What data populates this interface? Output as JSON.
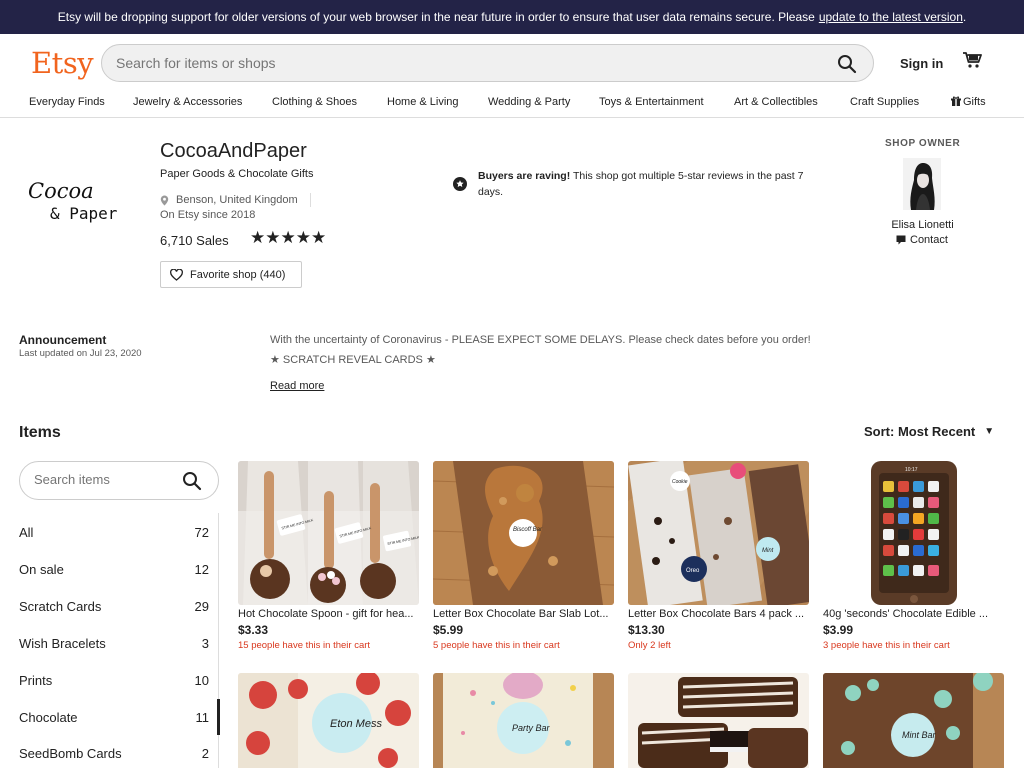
{
  "banner": {
    "text": "Etsy will be dropping support for older versions of your web browser in the near future in order to ensure that user data remains secure. Please",
    "link": "update to the latest version",
    "end": "."
  },
  "header": {
    "logo": "Etsy",
    "search_placeholder": "Search for items or shops",
    "signin": "Sign in"
  },
  "nav": [
    "Everyday Finds",
    "Jewelry & Accessories",
    "Clothing & Shoes",
    "Home & Living",
    "Wedding & Party",
    "Toys & Entertainment",
    "Art & Collectibles",
    "Craft Supplies",
    "Gifts"
  ],
  "shop": {
    "logo_line1": "Cocoa",
    "logo_line2": "& Paper",
    "name": "CocoaAndPaper",
    "tagline": "Paper Goods & Chocolate Gifts",
    "location": "Benson, United Kingdom",
    "since": "On Etsy since 2018",
    "sales": "6,710 Sales",
    "rating_stars": 5,
    "stars": "★★★★★",
    "favorite": "Favorite shop (440)"
  },
  "raving": {
    "bold": "Buyers are raving!",
    "text": " This shop got multiple 5-star reviews in the past 7 days."
  },
  "owner": {
    "heading": "SHOP OWNER",
    "name": "Elisa Lionetti",
    "contact": "Contact"
  },
  "announcement": {
    "title": "Announcement",
    "updated": "Last updated on Jul 23, 2020",
    "line1": "With the uncertainty of Coronavirus - PLEASE EXPECT SOME DELAYS. Please check dates before you order!",
    "line2": "★ SCRATCH REVEAL CARDS ★",
    "read_more": "Read more"
  },
  "items": {
    "heading": "Items",
    "sort": "Sort: Most Recent",
    "search_placeholder": "Search items",
    "sections": [
      {
        "name": "All",
        "count": "72"
      },
      {
        "name": "On sale",
        "count": "12"
      },
      {
        "name": "Scratch Cards",
        "count": "29"
      },
      {
        "name": "Wish Bracelets",
        "count": "3"
      },
      {
        "name": "Prints",
        "count": "10"
      },
      {
        "name": "Chocolate",
        "count": "11"
      },
      {
        "name": "SeedBomb Cards",
        "count": "2"
      }
    ],
    "listings": [
      {
        "title": "Hot Chocolate Spoon - gift for hea...",
        "price": "$3.33",
        "note": "15 people have this in their cart"
      },
      {
        "title": "Letter Box Chocolate Bar Slab Lot...",
        "price": "$5.99",
        "note": "5 people have this in their cart"
      },
      {
        "title": "Letter Box Chocolate Bars 4 pack ...",
        "price": "$13.30",
        "note": "Only 2 left"
      },
      {
        "title": "40g 'seconds' Chocolate Edible ...",
        "price": "$3.99",
        "note": "3 people have this in their cart"
      }
    ],
    "thumb_labels": {
      "spoon_tag": "STIR ME INTO MILK",
      "biscoff": "Biscoff Bar",
      "cookie": "Cookie",
      "mint": "Mint",
      "oreo": "Oreo",
      "phone_time": "10:17",
      "eton": "Eton Mess",
      "party": "Party Bar",
      "mint2": "Mint Bar",
      "brand": "Cocoa & Paper"
    }
  },
  "colors": {
    "brand": "#F1641E",
    "banner_bg": "#232347",
    "alert": "#D9381E"
  }
}
